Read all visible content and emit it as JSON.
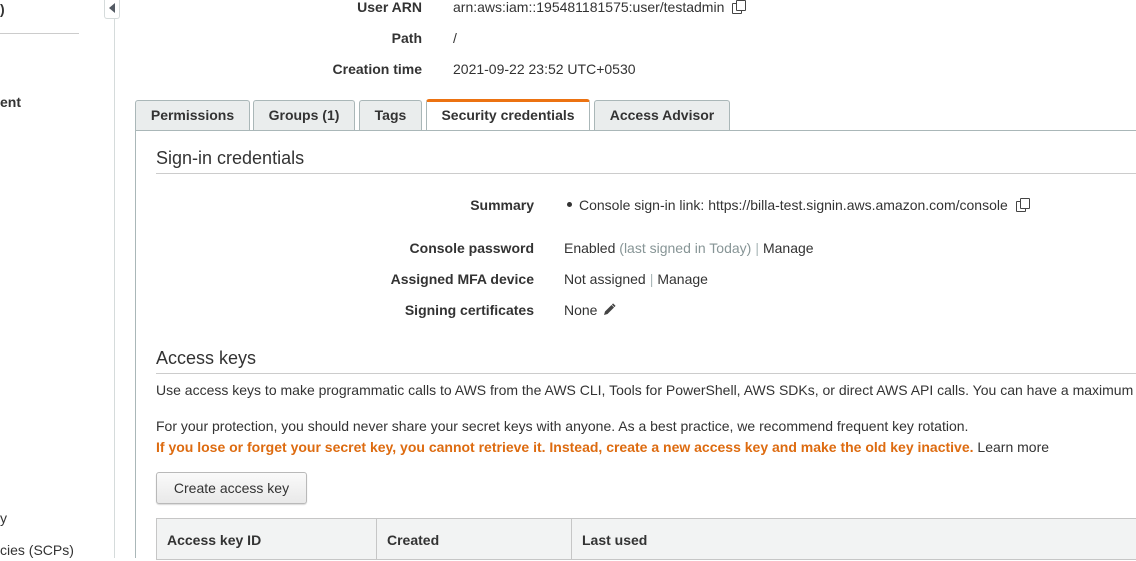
{
  "sidebar": {
    "fragments": [
      ")",
      "ent",
      "y",
      "cies (SCPs)"
    ]
  },
  "summary": {
    "rows": [
      {
        "label": "User ARN",
        "value": "arn:aws:iam::195481181575:user/testadmin"
      },
      {
        "label": "Path",
        "value": "/"
      },
      {
        "label": "Creation time",
        "value": "2021-09-22 23:52 UTC+0530"
      }
    ]
  },
  "tabs": [
    {
      "label": "Permissions"
    },
    {
      "label": "Groups (1)"
    },
    {
      "label": "Tags"
    },
    {
      "label": "Security credentials",
      "active": true
    },
    {
      "label": "Access Advisor"
    }
  ],
  "signin": {
    "title": "Sign-in credentials",
    "summary_label": "Summary",
    "console_link_label": "Console sign-in link:",
    "console_link_url": "https://billa-test.signin.aws.amazon.com/console",
    "password_label": "Console password",
    "password_value": "Enabled",
    "password_note": "(last signed in Today)",
    "password_action": "Manage",
    "mfa_label": "Assigned MFA device",
    "mfa_value": "Not assigned",
    "mfa_action": "Manage",
    "certs_label": "Signing certificates",
    "certs_value": "None"
  },
  "access_keys": {
    "title": "Access keys",
    "description": "Use access keys to make programmatic calls to AWS from the AWS CLI, Tools for PowerShell, AWS SDKs, or direct AWS API calls. You can have a maximum",
    "protection": "For your protection, you should never share your secret keys with anyone. As a best practice, we recommend frequent key rotation.",
    "warning": "If you lose or forget your secret key, you cannot retrieve it. Instead, create a new access key and make the old key inactive.",
    "learn_more": "Learn more",
    "create_button": "Create access key",
    "columns": [
      "Access key ID",
      "Created",
      "Last used"
    ]
  },
  "colors": {
    "accent": "#ec7211",
    "warning": "#dd6b10",
    "tab_bg": "#eaeded"
  },
  "icons": [
    "copy-icon",
    "pencil-icon",
    "collapse-arrow-icon"
  ]
}
